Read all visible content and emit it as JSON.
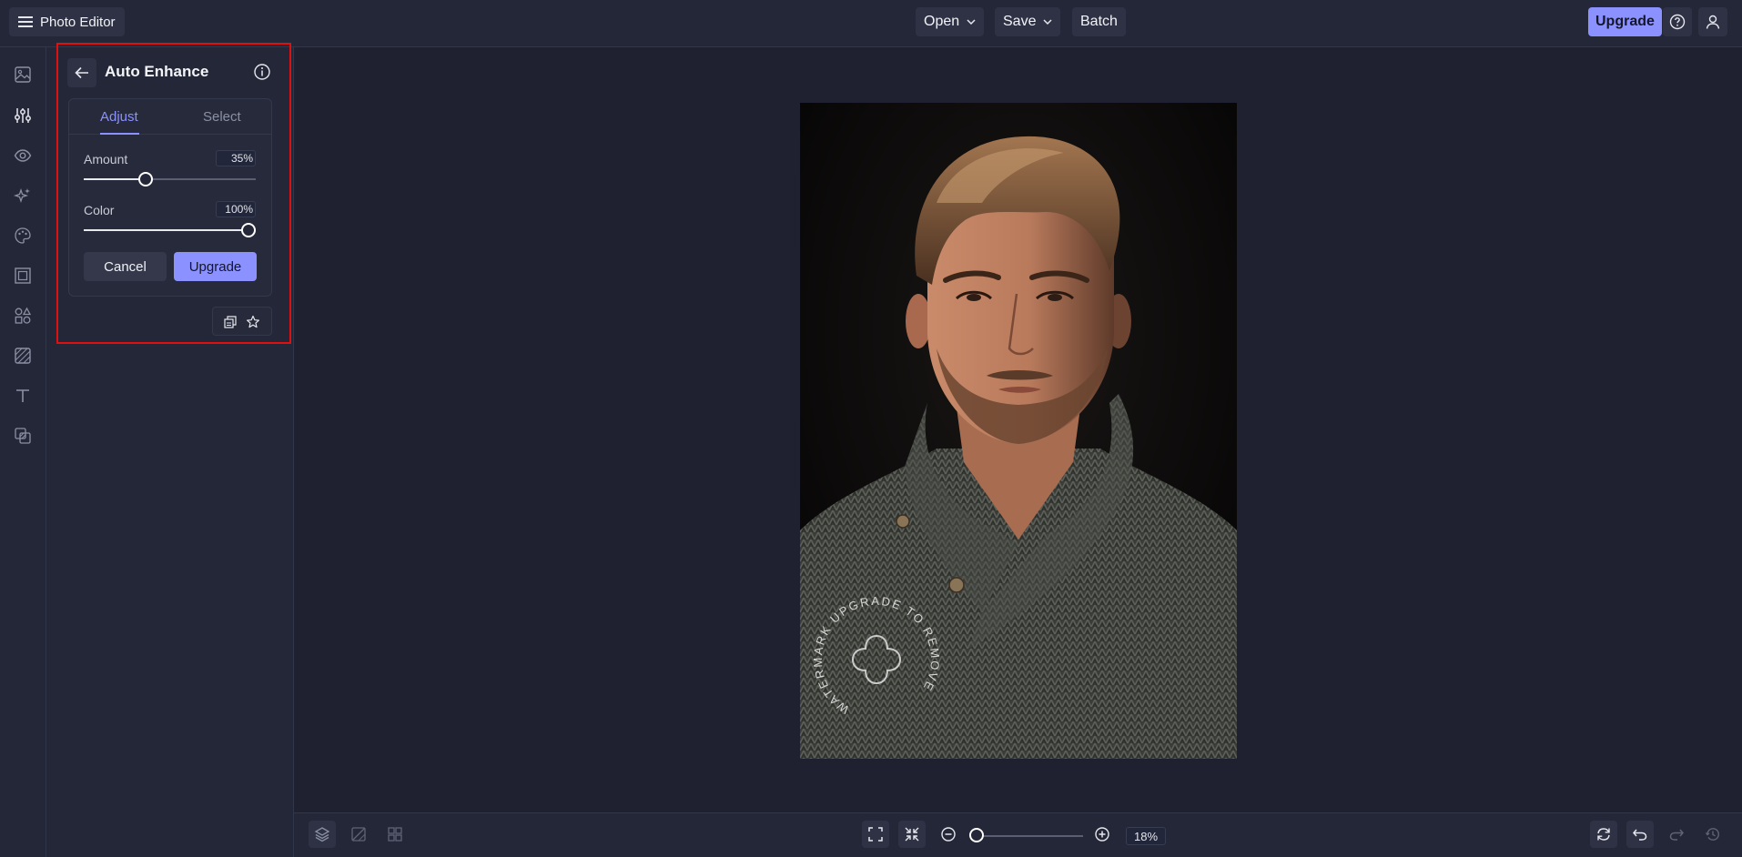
{
  "header": {
    "app_title": "Photo Editor",
    "menus": [
      {
        "label": "Open"
      },
      {
        "label": "Save"
      },
      {
        "label": "Batch"
      }
    ],
    "upgrade_label": "Upgrade"
  },
  "rail": {
    "items": [
      {
        "icon": "image-icon"
      },
      {
        "icon": "adjustments-icon",
        "active": true
      },
      {
        "icon": "eye-icon"
      },
      {
        "icon": "sparkle-effects-icon"
      },
      {
        "icon": "brush-palette-icon"
      },
      {
        "icon": "frame-icon"
      },
      {
        "icon": "shapes-icon"
      },
      {
        "icon": "texture-icon"
      },
      {
        "icon": "text-icon"
      },
      {
        "icon": "overlay-icon"
      }
    ]
  },
  "panel": {
    "title": "Auto Enhance",
    "tabs": [
      {
        "label": "Adjust",
        "active": true
      },
      {
        "label": "Select",
        "active": false
      }
    ],
    "sliders": [
      {
        "label": "Amount",
        "value_text": "35%",
        "value": 0.35
      },
      {
        "label": "Color",
        "value_text": "100%",
        "value": 1.0
      }
    ],
    "cancel_label": "Cancel",
    "upgrade_label": "Upgrade"
  },
  "bottom": {
    "zoom_text": "18%",
    "zoom_value": 0.18
  },
  "watermark": {
    "text": "WATERMARK UPGRADE TO REMOVE"
  },
  "colors": {
    "accent": "#8b91ff",
    "highlight": "#e01010"
  }
}
